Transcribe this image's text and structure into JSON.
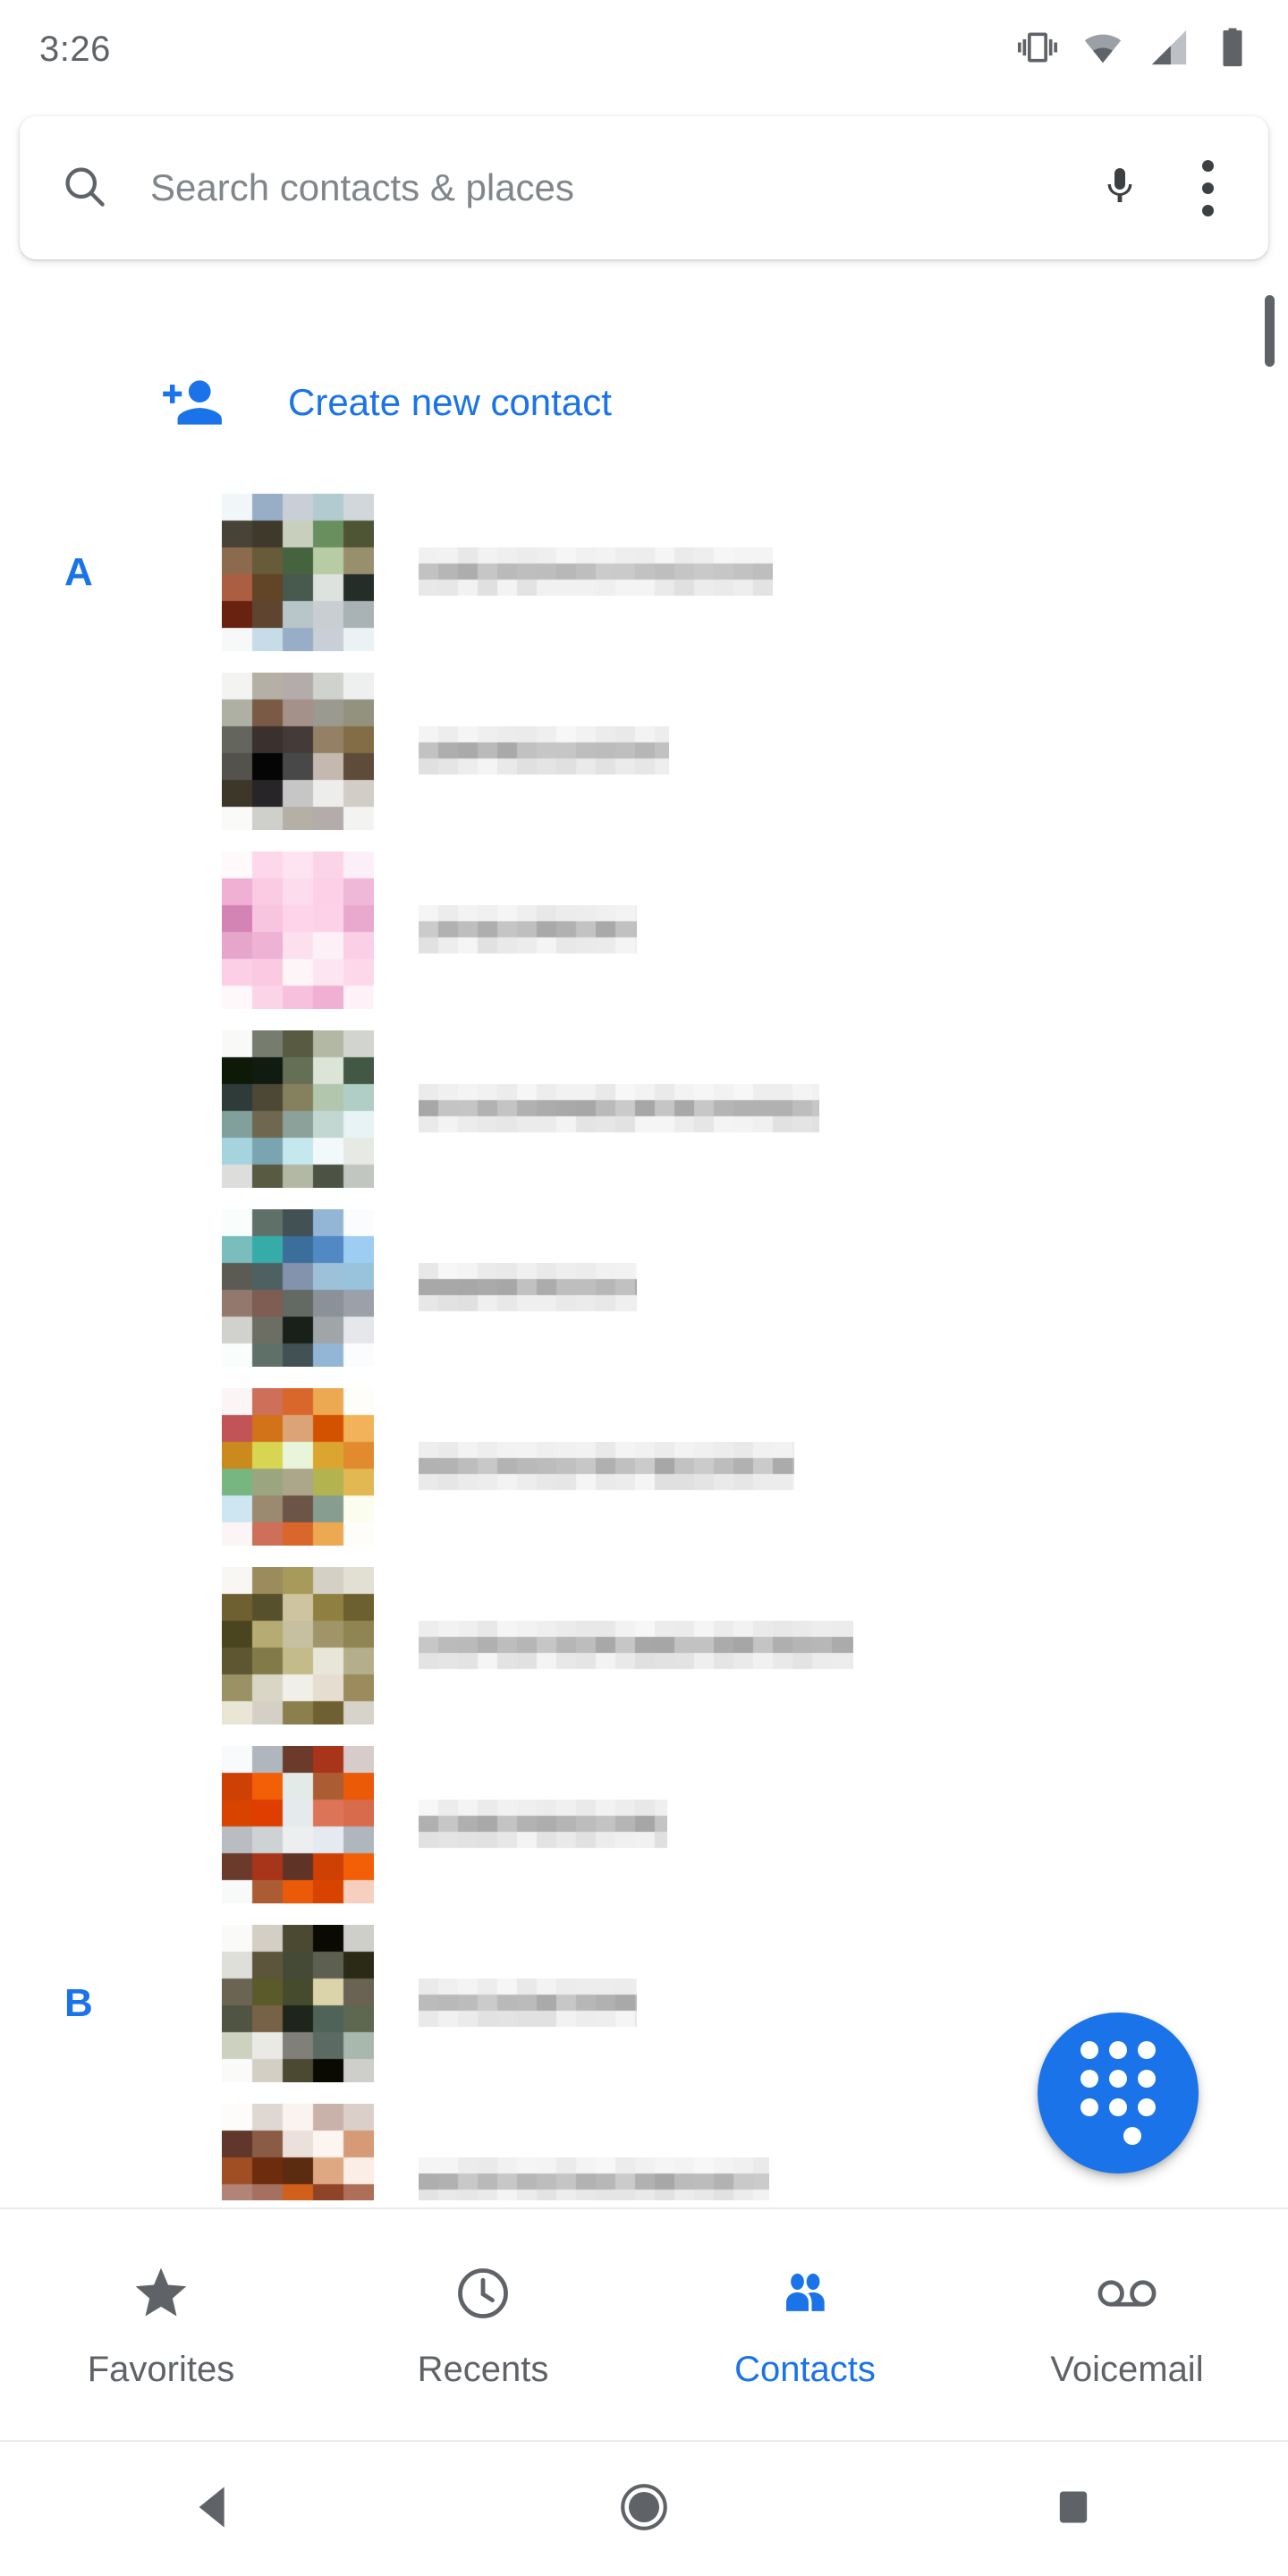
{
  "status_bar": {
    "time": "3:26",
    "icons": [
      "vibrate-icon",
      "wifi-icon",
      "cellular-signal-icon",
      "battery-icon"
    ]
  },
  "search": {
    "placeholder": "Search contacts & places",
    "value": "",
    "search_icon": "search-icon",
    "mic_icon": "microphone-icon",
    "overflow_icon": "more-vert-icon"
  },
  "create_new_contact": {
    "label": "Create new contact",
    "icon": "person-add-icon",
    "color": "#1a73e8"
  },
  "colors": {
    "accent": "#1a73e8",
    "text_primary": "#3c4043",
    "text_secondary": "#5f6368",
    "divider": "#e8eaed",
    "background": "#ffffff"
  },
  "contacts": {
    "section_headers": [
      "A",
      "B"
    ],
    "rows": [
      {
        "section": "A",
        "name_redacted": true,
        "name_blur_width": 396,
        "avatar_palette": [
          "#c6dde8",
          "#97aec6",
          "#c9cfd6",
          "#b1cbd1",
          "#47606a",
          "#474336",
          "#3f392b",
          "#c8d0bd",
          "#6a8f5f",
          "#4e5535",
          "#8c6a4e",
          "#675b39",
          "#46633f",
          "#b7cba4",
          "#988f6d",
          "#ab5e42",
          "#624427",
          "#485a4d",
          "#dde2de",
          "#242d28",
          "#692110",
          "#5f452f",
          "#b8c6ca",
          "#c8ced1",
          "#a9b3b5",
          "#e0e2e4"
        ]
      },
      {
        "section": "",
        "name_redacted": true,
        "name_blur_width": 280,
        "avatar_palette": [
          "#cfd0cb",
          "#b4b0a5",
          "#b4abab",
          "#cfd2cd",
          "#bbc3bf",
          "#adb0a2",
          "#7a5a44",
          "#a3918a",
          "#9b9a90",
          "#93927f",
          "#64655c",
          "#3a312f",
          "#443a38",
          "#948165",
          "#836d46",
          "#53524d",
          "#050505",
          "#484848",
          "#c5b9af",
          "#5e4b39",
          "#3c3729",
          "#272527",
          "#c6c6c6",
          "#ededeb",
          "#d2cec7",
          "#eaeae8"
        ]
      },
      {
        "section": "",
        "name_redacted": true,
        "name_blur_width": 244,
        "avatar_palette": [
          "#fde6f1",
          "#fdd8ea",
          "#fde4f0",
          "#fbd4e7",
          "#f7c1de",
          "#efb0d3",
          "#fbcae3",
          "#fddcee",
          "#fdd0e7",
          "#f0b8d8",
          "#d483b5",
          "#f7c5e0",
          "#fdd4e9",
          "#fdd2e8",
          "#e9a9ce",
          "#e6a6cb",
          "#eeb2d5",
          "#fde0ee",
          "#fdf0f6",
          "#fbcfe5",
          "#fdcfe6",
          "#fbcae2",
          "#fef5f9"
        ]
      },
      {
        "section": "",
        "name_redacted": true,
        "name_blur_width": 448,
        "avatar_palette": [
          "#e7e9e5",
          "#767d6f",
          "#585a42",
          "#b2b8a4",
          "#4c5244",
          "#0d1a08",
          "#101c0f",
          "#656f55",
          "#dbe4d6",
          "#425845",
          "#2e3b38",
          "#4d4735",
          "#85815f",
          "#b2c6ad",
          "#b0cdc6",
          "#81a09c",
          "#706751",
          "#8ba19a",
          "#c2d6d2",
          "#e7f3f4",
          "#a5d3de",
          "#7ba4b1",
          "#c5e7ee",
          "#f1f9fa"
        ]
      },
      {
        "section": "",
        "name_redacted": true,
        "name_blur_width": 244,
        "avatar_palette": [
          "#e9f6f4",
          "#5f7069",
          "#415154",
          "#93b5d6",
          "#eff3f7",
          "#79bdbd",
          "#36aca8",
          "#3c6e9b",
          "#5089c4",
          "#9dcdf2",
          "#5c5b53",
          "#4f6063",
          "#8493ad",
          "#9dc1d9",
          "#99c2dc",
          "#93796d",
          "#7e5d52",
          "#636a64",
          "#8b9199",
          "#9ba0a9",
          "#d1d2ce",
          "#6c6e63",
          "#182019",
          "#a0a5a8",
          "#e5e7ea"
        ]
      },
      {
        "section": "",
        "name_redacted": true,
        "name_blur_width": 420,
        "avatar_palette": [
          "#eedad8",
          "#cd6f59",
          "#d9662a",
          "#eca952",
          "#fdf8e9",
          "#c25458",
          "#d2731a",
          "#daa476",
          "#d25200",
          "#f2b25a",
          "#cb8a1d",
          "#d7d551",
          "#e8f5db",
          "#dba52f",
          "#e18b2e",
          "#78b681",
          "#9ba57f",
          "#aca68b",
          "#b3b44f",
          "#e1b851",
          "#cde6f1",
          "#9b8a6f",
          "#6c5446",
          "#879d90",
          "#fbfdee"
        ]
      },
      {
        "section": "",
        "name_redacted": true,
        "name_blur_width": 486,
        "avatar_palette": [
          "#e5ded0",
          "#9b8b5d",
          "#a89a5b",
          "#d5d0c5",
          "#8c7f4e",
          "#6f6031",
          "#57502c",
          "#cfc4a0",
          "#8f8041",
          "#6d6030",
          "#4b451f",
          "#b5ab73",
          "#c6c0a1",
          "#a09568",
          "#8e8553",
          "#5d5631",
          "#837a49",
          "#c4bb8a",
          "#e8e6d8",
          "#b5ae8c",
          "#9a9265",
          "#d9d6c5",
          "#f0efe8"
        ]
      },
      {
        "section": "",
        "name_redacted": true,
        "name_blur_width": 278,
        "avatar_palette": [
          "#e4eaf0",
          "#b0b6bd",
          "#6b3a2a",
          "#a8341a",
          "#5f3426",
          "#cf4005",
          "#f25f07",
          "#e2ebe7",
          "#ac5c32",
          "#ea5a07",
          "#d84400",
          "#df3e00",
          "#e5eaed",
          "#dd7357",
          "#d76b4c",
          "#b9bcc0",
          "#cdd2d4",
          "#edeeef"
        ]
      },
      {
        "section": "B",
        "name_redacted": true,
        "name_blur_width": 244,
        "avatar_palette": [
          "#eceee9",
          "#d3cfc4",
          "#4c4932",
          "#0a0a03",
          "#3a3b2c",
          "#dedfd9",
          "#5d543c",
          "#454a36",
          "#5d6051",
          "#2a2a17",
          "#6b6452",
          "#5b5a2a",
          "#474b2e",
          "#dbd3a9",
          "#6a6253",
          "#4f5443",
          "#776247",
          "#1f251a",
          "#4f6359",
          "#5e6851",
          "#cdd1bf",
          "#e9e9e5",
          "#807f79",
          "#5b6b64",
          "#a9b8ae"
        ]
      },
      {
        "section": "",
        "name_redacted": true,
        "name_blur_width": 392,
        "avatar_palette": [
          "#faf2ee",
          "#ded7d2",
          "#fbf3f0",
          "#c9b2aa",
          "#6e4126",
          "#60372a",
          "#8a5b45",
          "#ece0da",
          "#fdf5ef",
          "#d79a76",
          "#a04f24",
          "#6c2c0d",
          "#5c2c10",
          "#dda882",
          "#fbeee6",
          "#b28477",
          "#a5705f",
          "#d2601c",
          "#8f4427",
          "#ae6e57",
          "#463226",
          "#221710",
          "#c5a08c"
        ]
      }
    ]
  },
  "fab": {
    "name": "dialpad-fab",
    "icon": "dialpad-icon",
    "color": "#1a73e8"
  },
  "bottom_tabs": [
    {
      "label": "Favorites",
      "icon": "star-icon",
      "active": false
    },
    {
      "label": "Recents",
      "icon": "clock-icon",
      "active": false
    },
    {
      "label": "Contacts",
      "icon": "people-icon",
      "active": true
    },
    {
      "label": "Voicemail",
      "icon": "voicemail-icon",
      "active": false
    }
  ],
  "android_nav": [
    {
      "name": "back-button",
      "icon": "triangle-back-icon"
    },
    {
      "name": "home-button",
      "icon": "circle-home-icon"
    },
    {
      "name": "recents-button",
      "icon": "square-recents-icon"
    }
  ]
}
